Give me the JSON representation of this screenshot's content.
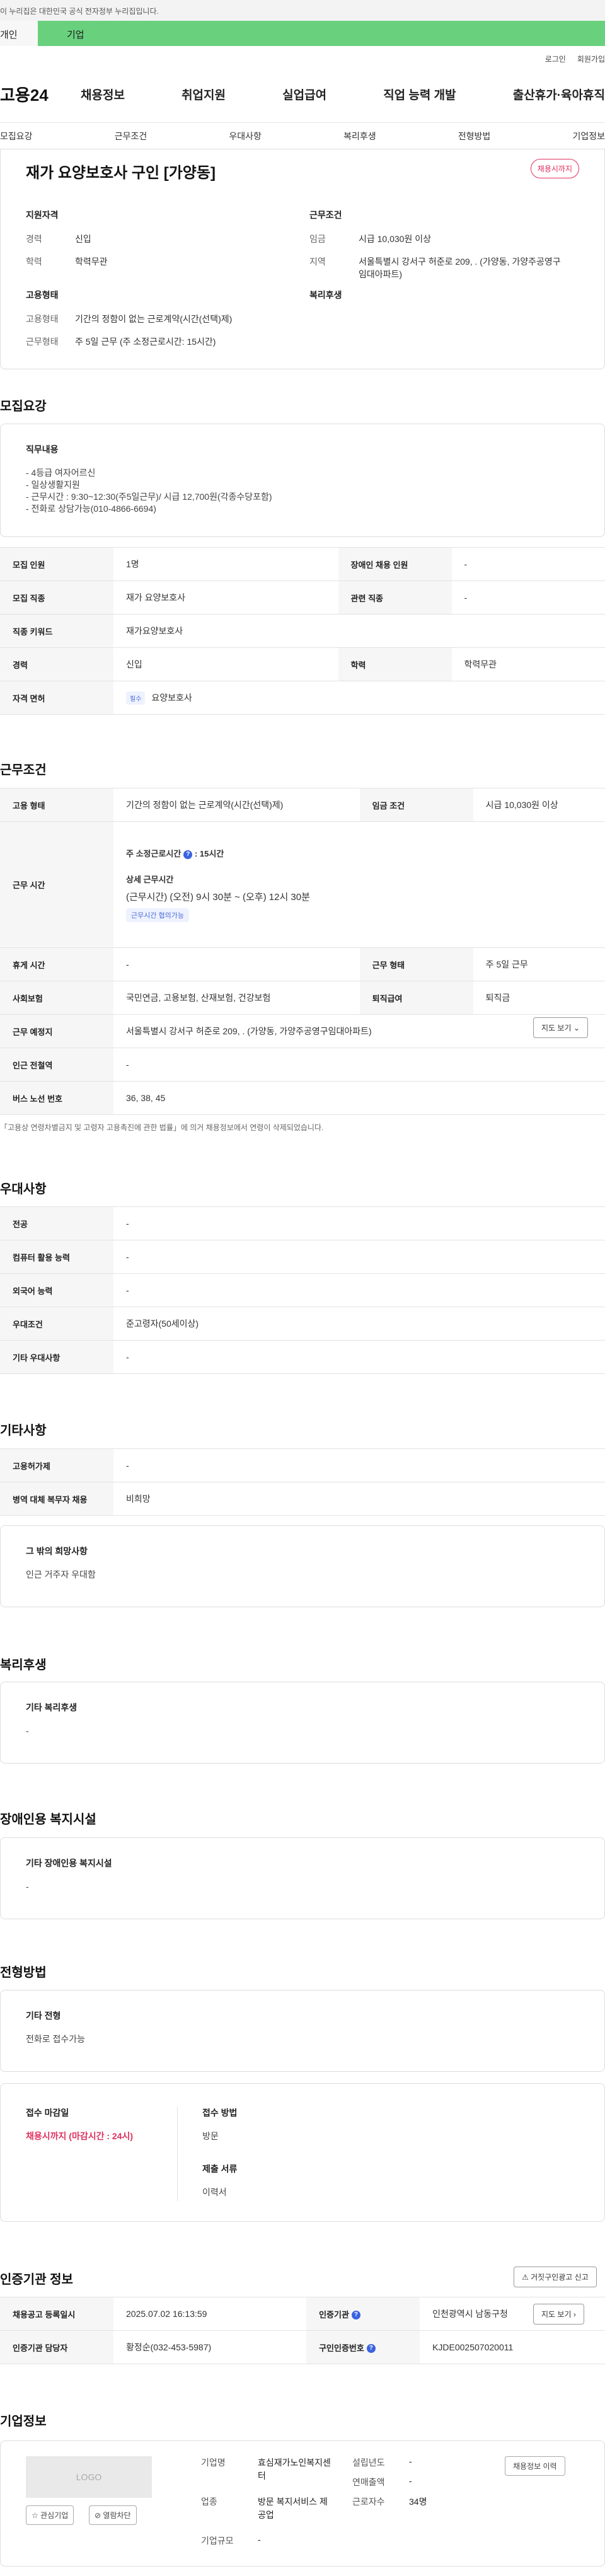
{
  "govbar": {
    "text": "이 누리집은 대한민국 공식 전자정부 누리집입니다."
  },
  "usertabs": {
    "individual": "개인",
    "company": "기업"
  },
  "util": {
    "login": "로그인",
    "signup": "회원가입"
  },
  "gnb": {
    "logo": "고용24",
    "menu": [
      "채용정보",
      "취업지원",
      "실업급여",
      "직업 능력 개발",
      "출산휴가·육아휴직"
    ]
  },
  "subnav": [
    "모집요강",
    "근무조건",
    "우대사항",
    "복리후생",
    "전형방법",
    "기업정보"
  ],
  "summary": {
    "title": "재가 요양보호사 구인 [가양동]",
    "badge": "채용시까지",
    "qualifications": {
      "head": "지원자격",
      "rows": [
        {
          "k": "경력",
          "v": "신입"
        },
        {
          "k": "학력",
          "v": "학력무관"
        }
      ]
    },
    "conditions": {
      "head": "근무조건",
      "rows": [
        {
          "k": "임금",
          "v": "시급 10,030원 이상"
        },
        {
          "k": "지역",
          "v": "서울특별시 강서구 허준로 209, . (가양동, 가양주공영구임대아파트)"
        }
      ]
    },
    "employment": {
      "head": "고용형태",
      "rows": [
        {
          "k": "고용형태",
          "v": "기간의 정함이 없는 근로계약(시간(선택)제)"
        },
        {
          "k": "근무형태",
          "v": "주 5일 근무 (주 소정근로시간: 15시간)"
        }
      ]
    },
    "welfare": {
      "head": "복리후생"
    }
  },
  "recruit": {
    "section_title": "모집요강",
    "duty_head": "직무내용",
    "duty_lines": [
      "- 4등급 여자어르신",
      "- 일상생활지원",
      "- 근무시간 : 9:30~12:30(주5일근무)/ 시급 12,700원(각종수당포함)",
      "- 전화로 상담가능(010-4866-6694)"
    ],
    "rows": [
      {
        "k1": "모집 인원",
        "v1": "1명",
        "k2": "장애인 채용 인원",
        "v2": "-"
      },
      {
        "k1": "모집 직종",
        "v1": "재가 요양보호사",
        "k2": "관련 직종",
        "v2": "-"
      },
      {
        "k1": "직종 키워드",
        "v1": "재가요양보호사"
      },
      {
        "k1": "경력",
        "v1": "신입",
        "k2": "학력",
        "v2": "학력무관"
      },
      {
        "k1": "자격 면허",
        "tag": "필수",
        "v1": "요양보호사"
      }
    ]
  },
  "work": {
    "section_title": "근무조건",
    "type_k": "고용 형태",
    "type_v": "기간의 정함이 없는 근로계약(시간(선택)제)",
    "wage_k": "임금 조건",
    "wage_v": "시급 10,030원 이상",
    "hours_k": "근무 시간",
    "hours_weekly_label": "주 소정근로시간",
    "hours_weekly_value": ": 15시간",
    "hours_detail_head": "상세 근무시간",
    "hours_detail": "(근무시간) (오전) 9시 30분 ~ (오후) 12시 30분",
    "hours_tag": "근무시간 협의가능",
    "rest_k": "휴게 시간",
    "rest_v": "-",
    "form_k": "근무 형태",
    "form_v": "주 5일 근무",
    "ins_k": "사회보험",
    "ins_v": "국민연금, 고용보험, 산재보험, 건강보험",
    "sev_k": "퇴직급여",
    "sev_v": "퇴직금",
    "place_k": "근무 예정지",
    "place_v": "서울특별시 강서구 허준로 209, . (가양동, 가양주공영구임대아파트)",
    "map_btn": "지도 보기",
    "subway_k": "인근 전철역",
    "subway_v": "-",
    "bus_k": "버스 노선 번호",
    "bus_v": "36, 38, 45",
    "note": "「고용상 연령차별금지 및 고령자 고용촉진에 관한 법률」에 의거 채용정보에서 연령이 삭제되었습니다."
  },
  "prefer": {
    "section_title": "우대사항",
    "rows": [
      {
        "k": "전공",
        "v": "-"
      },
      {
        "k": "컴퓨터 활용 능력",
        "v": "-"
      },
      {
        "k": "외국어 능력",
        "v": "-"
      },
      {
        "k": "우대조건",
        "v": "준고령자(50세이상)"
      },
      {
        "k": "기타 우대사항",
        "v": "-"
      }
    ]
  },
  "etc": {
    "section_title": "기타사항",
    "rows": [
      {
        "k": "고용허가제",
        "v": "-"
      },
      {
        "k": "병역 대체 복무자 채용",
        "v": "비희망"
      }
    ],
    "other_head": "그 밖의 희망사항",
    "other_text": "인근 거주자 우대함"
  },
  "benefit": {
    "section_title": "복리후생",
    "head": "기타 복리후생",
    "text": "-"
  },
  "disabled": {
    "section_title": "장애인용 복지시설",
    "head": "기타 장애인용 복지시설",
    "text": "-"
  },
  "selection": {
    "section_title": "전형방법",
    "head": "기타 전형",
    "text": "전화로 접수가능",
    "deadline_head": "접수 마감일",
    "deadline_text": "채용시까지 (마감시간 : 24시)",
    "method_head": "접수 방법",
    "method_text": "방문",
    "docs_head": "제출 서류",
    "docs_text": "이력서"
  },
  "agency": {
    "section_title": "인증기관 정보",
    "report_btn": "거짓구인광고 신고",
    "rows": [
      {
        "k1": "채용공고 등록일시",
        "v1": "2025.07.02 16:13:59",
        "k2": "인증기관",
        "v2": "인천광역시 남동구청",
        "btn": "지도 보기"
      },
      {
        "k1": "인증기관 담당자",
        "v1": "황정순(032-453-5987)",
        "k2": "구인인증번호",
        "v2": "KJDE002507020011"
      }
    ]
  },
  "company": {
    "section_title": "기업정보",
    "logo_text": "LOGO",
    "interest_btn": "관심기업",
    "block_btn": "열람차단",
    "history_btn": "채용정보 이력",
    "name_k": "기업명",
    "name_v": "효심재가노인복지센터",
    "industry_k": "업종",
    "industry_v": "방문 복지서비스 제공업",
    "size_k": "기업규모",
    "size_v": "-",
    "founded_k": "설립년도",
    "founded_v": "-",
    "revenue_k": "연매출액",
    "revenue_v": "-",
    "staff_k": "근로자수",
    "staff_v": "34명"
  }
}
